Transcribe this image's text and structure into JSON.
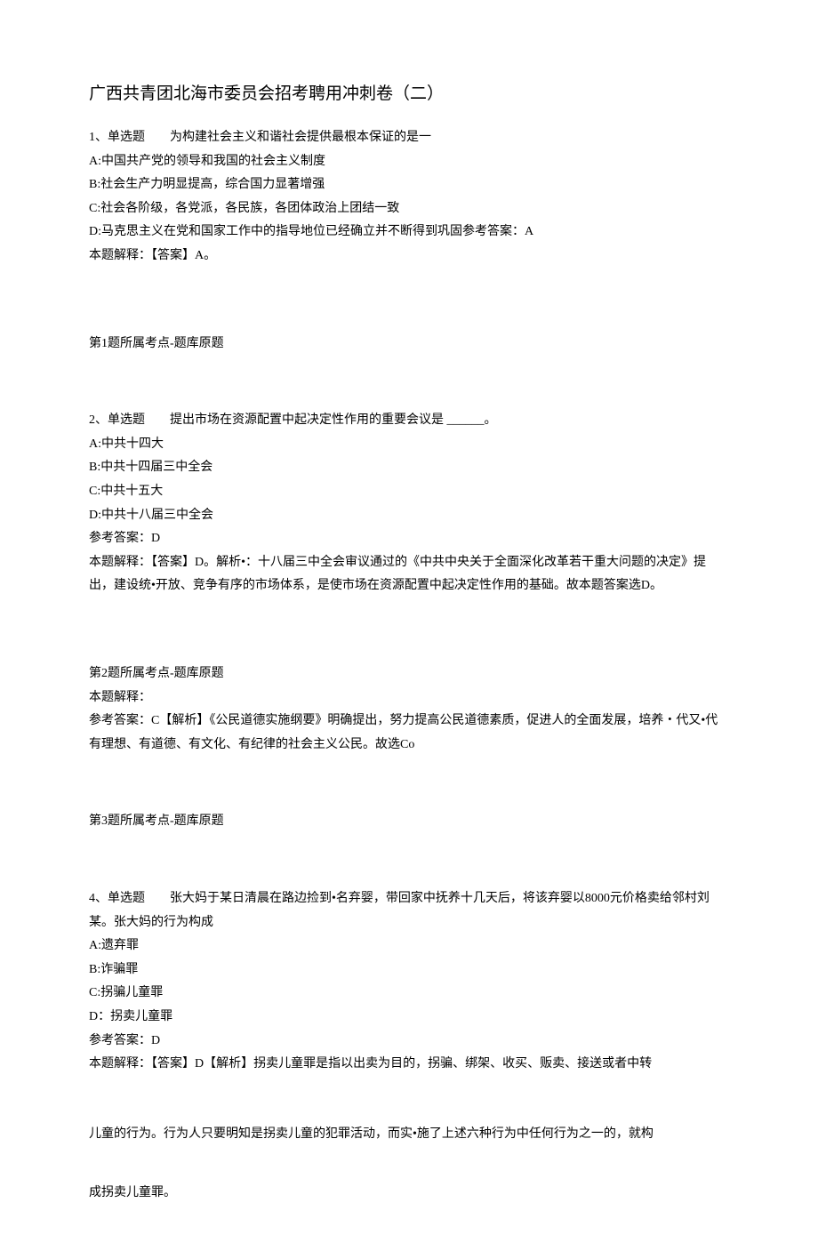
{
  "title": "广西共青团北海市委员会招考聘用冲刺卷（二）",
  "q1": {
    "stem": "1、单选题　　为构建社会主义和谐社会提供最根本保证的是一",
    "optA": "A:中国共产党的领导和我国的社会主义制度",
    "optB": "B:社会生产力明显提高，综合国力显著增强",
    "optC": "C:社会各阶级，各党派，各民族，各团体政治上团结一致",
    "optD_and_ref": "D:马克思主义在党和国家工作中的指导地位已经确立并不断得到巩固参考答案：A",
    "explain": "本题解释：【答案】A。",
    "topic": "第1题所属考点-题库原题"
  },
  "q2": {
    "stem": "2、单选题　　提出市场在资源配置中起决定性作用的重要会议是 ______。",
    "optA": "A:中共十四大",
    "optB": "B:中共十四届三中全会",
    "optC": "C:中共十五大",
    "optD": "D:中共十八届三中全会",
    "ref": "参考答案：D",
    "explain": "本题解释：【答案】D。解析•：十八届三中全会审议通过的《中共中央关于全面深化改革若干重大问题的决定》提出，建设统•开放、竞争有序的市场体系，是使市场在资源配置中起决定性作用的基础。故本题答案选D。",
    "topic": "第2题所属考点-题库原题"
  },
  "q3": {
    "explain_label": "本题解释：",
    "explain": "参考答案：C【解析】《公民道德实施纲要》明确提出，努力提高公民道德素质，促进人的全面发展，培养・代又•代有理想、有道德、有文化、有纪律的社会主义公民。故选Co",
    "topic": "第3题所属考点-题库原题"
  },
  "q4": {
    "stem": "4、单选题　　张大妈于某日清晨在路边捡到•名弃婴，带回家中抚养十几天后，将该弃婴以8000元价格卖给邻村刘某。张大妈的行为构成",
    "optA": "A:遗弃罪",
    "optB": "B:诈骗罪",
    "optC": "C:拐骗儿童罪",
    "optD": "D：拐卖儿童罪",
    "ref": "参考答案：D",
    "explain1": "本题解释：【答案】D【解析】拐卖儿童罪是指以出卖为目的，拐骗、绑架、收买、贩卖、接送或者中转",
    "explain2": "儿童的行为。行为人只要明知是拐卖儿童的犯罪活动，而实•施了上述六种行为中任何行为之一的，就构",
    "explain3": "成拐卖儿童罪。"
  }
}
